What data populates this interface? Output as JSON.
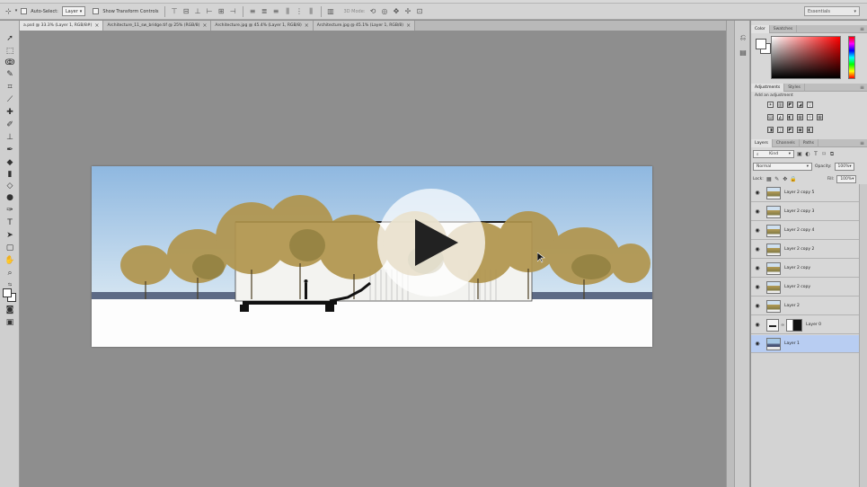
{
  "options_bar": {
    "auto_select_label": "Auto-Select:",
    "auto_select_value": "Layer",
    "show_transform_label": "Show Transform Controls",
    "mode_label": "3D Mode:",
    "workspace": "Essentials"
  },
  "tabs": [
    {
      "label": "a.psd @ 33.3% (Layer 1, RGB/8#)",
      "active": true
    },
    {
      "label": "Architecture_11_sw_bridge.tif @ 25% (RGB/8)",
      "active": false
    },
    {
      "label": "Architecture.jpg @ 45.4% (Layer 1, RGB/8)",
      "active": false
    },
    {
      "label": "Architecture.jpg @ 45.1% (Layer 1, RGB/8)",
      "active": false
    }
  ],
  "color_panel": {
    "tabs": [
      "Color",
      "Swatches"
    ],
    "fg": "#ffffff",
    "bg": "#ffffff"
  },
  "adjustments_panel": {
    "tabs": [
      "Adjustments",
      "Styles"
    ],
    "title": "Add an adjustment",
    "row1": [
      "☀",
      "▥",
      "◩",
      "◪",
      "▽"
    ],
    "row2": [
      "▤",
      "◭",
      "◧",
      "▦",
      "⟐",
      "▦"
    ],
    "row3": [
      "◨",
      "◫",
      "◩",
      "▣",
      "◧"
    ]
  },
  "layers_panel": {
    "tabs": [
      "Layers",
      "Channels",
      "Paths"
    ],
    "filter_label": "Kind",
    "blend_mode": "Normal",
    "opacity_label": "Opacity:",
    "opacity_value": "100%",
    "lock_label": "Lock:",
    "fill_label": "Fill:",
    "fill_value": "100%",
    "layers": [
      {
        "name": "Layer 2 copy 5",
        "thumb": "tree"
      },
      {
        "name": "Layer 2 copy 3",
        "thumb": "tree"
      },
      {
        "name": "Layer 2 copy 4",
        "thumb": "tree"
      },
      {
        "name": "Layer 2 copy 2",
        "thumb": "tree"
      },
      {
        "name": "Layer 2 copy",
        "thumb": "tree"
      },
      {
        "name": "Layer 2 copy",
        "thumb": "tree"
      },
      {
        "name": "Layer 2",
        "thumb": "tree"
      },
      {
        "name": "Layer 0",
        "thumb": "mask"
      },
      {
        "name": "Layer 1",
        "thumb": "photo",
        "selected": true
      }
    ]
  },
  "video": {
    "play_icon": "play-icon"
  }
}
